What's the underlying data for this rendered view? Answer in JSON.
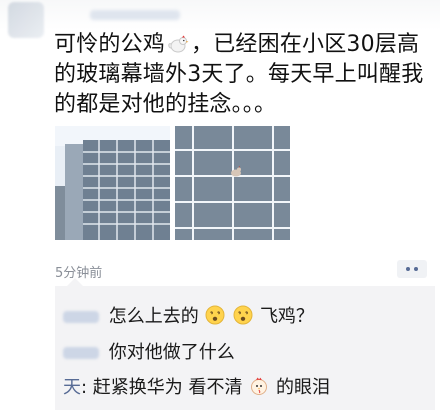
{
  "post": {
    "text_before_icon": "可怜的公鸡",
    "icon": "rooster-icon",
    "text_after_icon": "，已经困在小区30层高的玻璃幕墙外3天了。每天早上叫醒我的都是对他的挂念。。。",
    "images": [
      {
        "name": "building-photo-1"
      },
      {
        "name": "building-photo-2"
      }
    ],
    "time": "5分钟前",
    "more_icon": "more-dots-icon"
  },
  "comments": [
    {
      "author": "",
      "text_before": "怎么上去的",
      "emojis": [
        "dizzy-face-emoji",
        "dizzy-face-emoji"
      ],
      "text_after": "飞鸡？"
    },
    {
      "author": "",
      "text": "你对他做了什么"
    },
    {
      "author": "天",
      "sep": ": ",
      "text_before": "赶紧换华为 看不清",
      "emoji": "rooster-head-emoji",
      "text_after": "的眼泪"
    }
  ]
}
